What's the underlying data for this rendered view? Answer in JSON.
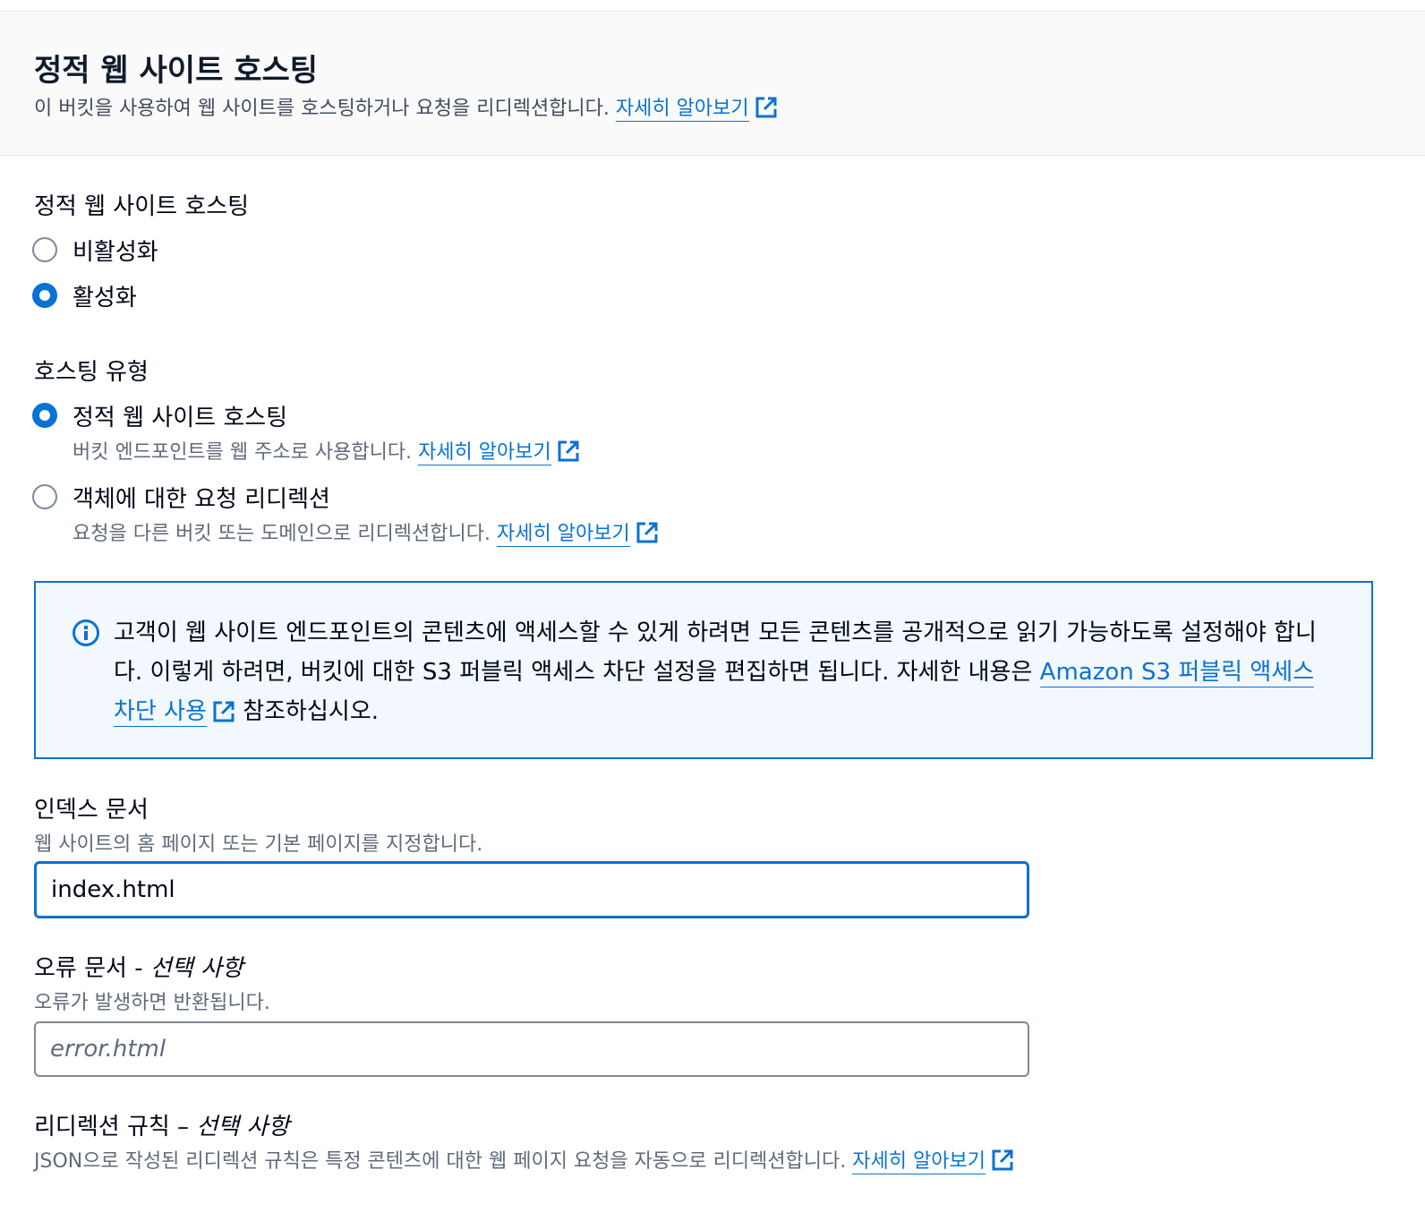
{
  "header": {
    "title": "정적 웹 사이트 호스팅",
    "description": "이 버킷을 사용하여 웹 사이트를 호스팅하거나 요청을 리디렉션합니다.",
    "learn_more": "자세히 알아보기"
  },
  "hosting_toggle": {
    "label": "정적 웹 사이트 호스팅",
    "options": [
      {
        "label": "비활성화",
        "selected": false
      },
      {
        "label": "활성화",
        "selected": true
      }
    ]
  },
  "hosting_type": {
    "label": "호스팅 유형",
    "options": [
      {
        "label": "정적 웹 사이트 호스팅",
        "description": "버킷 엔드포인트를 웹 주소로 사용합니다.",
        "learn_more": "자세히 알아보기",
        "selected": true
      },
      {
        "label": "객체에 대한 요청 리디렉션",
        "description": "요청을 다른 버킷 또는 도메인으로 리디렉션합니다.",
        "learn_more": "자세히 알아보기",
        "selected": false
      }
    ]
  },
  "info_alert": {
    "text_before": "고객이 웹 사이트 엔드포인트의 콘텐츠에 액세스할 수 있게 하려면 모든 콘텐츠를 공개적으로 읽기 가능하도록 설정해야 합니다. 이렇게 하려면, 버킷에 대한 S3 퍼블릭 액세스 차단 설정을 편집하면 됩니다. 자세한 내용은 ",
    "link": "Amazon S3 퍼블릭 액세스 차단 사용",
    "text_after": " 참조하십시오."
  },
  "index_document": {
    "label": "인덱스 문서",
    "description": "웹 사이트의 홈 페이지 또는 기본 페이지를 지정합니다.",
    "value": "index.html"
  },
  "error_document": {
    "label": "오류 문서 - ",
    "optional": "선택 사항",
    "description": "오류가 발생하면 반환됩니다.",
    "placeholder": "error.html",
    "value": ""
  },
  "redirection_rules": {
    "label": "리디렉션 규칙 – ",
    "optional": "선택 사항",
    "description": "JSON으로 작성된 리디렉션 규칙은 특정 콘텐츠에 대한 웹 페이지 요청을 자동으로 리디렉션합니다.",
    "learn_more": "자세히 알아보기"
  },
  "colors": {
    "accent": "#0972d3",
    "info_background": "#f2f8fd",
    "header_background": "#fafafa"
  }
}
